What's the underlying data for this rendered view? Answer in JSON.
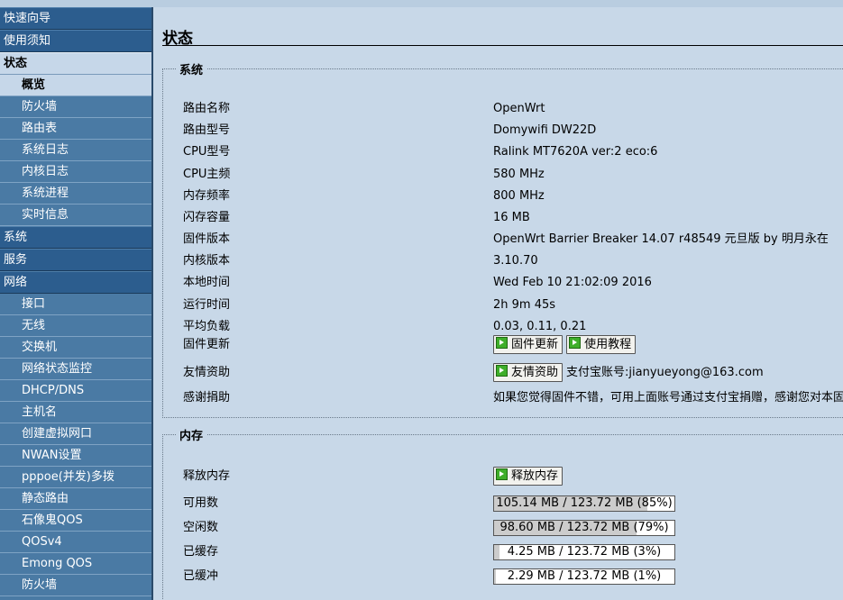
{
  "sidebar": {
    "items": [
      {
        "label": "快速向导",
        "kind": "menu"
      },
      {
        "label": "使用须知",
        "kind": "menu"
      },
      {
        "label": "状态",
        "kind": "menu",
        "active": true
      },
      {
        "label": "概览",
        "kind": "sub",
        "active": true
      },
      {
        "label": "防火墙",
        "kind": "sub"
      },
      {
        "label": "路由表",
        "kind": "sub"
      },
      {
        "label": "系统日志",
        "kind": "sub"
      },
      {
        "label": "内核日志",
        "kind": "sub"
      },
      {
        "label": "系统进程",
        "kind": "sub"
      },
      {
        "label": "实时信息",
        "kind": "sub"
      },
      {
        "label": "系统",
        "kind": "menu"
      },
      {
        "label": "服务",
        "kind": "menu"
      },
      {
        "label": "网络",
        "kind": "menu"
      },
      {
        "label": "接口",
        "kind": "sub"
      },
      {
        "label": "无线",
        "kind": "sub"
      },
      {
        "label": "交换机",
        "kind": "sub"
      },
      {
        "label": "网络状态监控",
        "kind": "sub"
      },
      {
        "label": "DHCP/DNS",
        "kind": "sub"
      },
      {
        "label": "主机名",
        "kind": "sub"
      },
      {
        "label": "创建虚拟网口",
        "kind": "sub"
      },
      {
        "label": "NWAN设置",
        "kind": "sub"
      },
      {
        "label": "pppoe(并发)多拨",
        "kind": "sub"
      },
      {
        "label": "静态路由",
        "kind": "sub"
      },
      {
        "label": "石像鬼QOS",
        "kind": "sub"
      },
      {
        "label": "QOSv4",
        "kind": "sub"
      },
      {
        "label": "Emong QOS",
        "kind": "sub"
      },
      {
        "label": "防火墙",
        "kind": "sub"
      }
    ]
  },
  "page": {
    "title": "状态"
  },
  "system": {
    "legend": "系统",
    "rows": [
      {
        "label": "路由名称",
        "value": "OpenWrt"
      },
      {
        "label": "路由型号",
        "value": "Domywifi DW22D"
      },
      {
        "label": "CPU型号",
        "value": "Ralink MT7620A ver:2 eco:6"
      },
      {
        "label": "CPU主频",
        "value": "580 MHz"
      },
      {
        "label": "内存频率",
        "value": "800 MHz"
      },
      {
        "label": "闪存容量",
        "value": "16 MB"
      },
      {
        "label": "固件版本",
        "value": "OpenWrt Barrier Breaker 14.07 r48549 元旦版 by 明月永在"
      },
      {
        "label": "内核版本",
        "value": "3.10.70"
      },
      {
        "label": "本地时间",
        "value": "Wed Feb 10 21:02:09 2016"
      },
      {
        "label": "运行时间",
        "value": "2h 9m 45s"
      },
      {
        "label": "平均负载",
        "value": "0.03, 0.11, 0.21"
      }
    ],
    "firmware_update": {
      "label": "固件更新",
      "update_button": "固件更新",
      "tutorial_button": "使用教程"
    },
    "donate": {
      "label": "友情资助",
      "button": "友情资助",
      "account": "支付宝账号:jianyueyong@163.com"
    },
    "thanks": {
      "label": "感谢捐助",
      "text": "如果您觉得固件不错，可用上面账号通过支付宝捐赠，感谢您对本固件的认可"
    }
  },
  "memory": {
    "legend": "内存",
    "release": {
      "label": "释放内存",
      "button": "释放内存"
    },
    "bars": [
      {
        "label": "可用数",
        "text": "105.14 MB / 123.72 MB (85%)",
        "percent": 85
      },
      {
        "label": "空闲数",
        "text": "98.60 MB / 123.72 MB (79%)",
        "percent": 79
      },
      {
        "label": "已缓存",
        "text": "4.25 MB / 123.72 MB (3%)",
        "percent": 3
      },
      {
        "label": "已缓冲",
        "text": "2.29 MB / 123.72 MB (1%)",
        "percent": 1
      }
    ]
  },
  "icons": {
    "button_icon": "green-arrow-icon"
  }
}
